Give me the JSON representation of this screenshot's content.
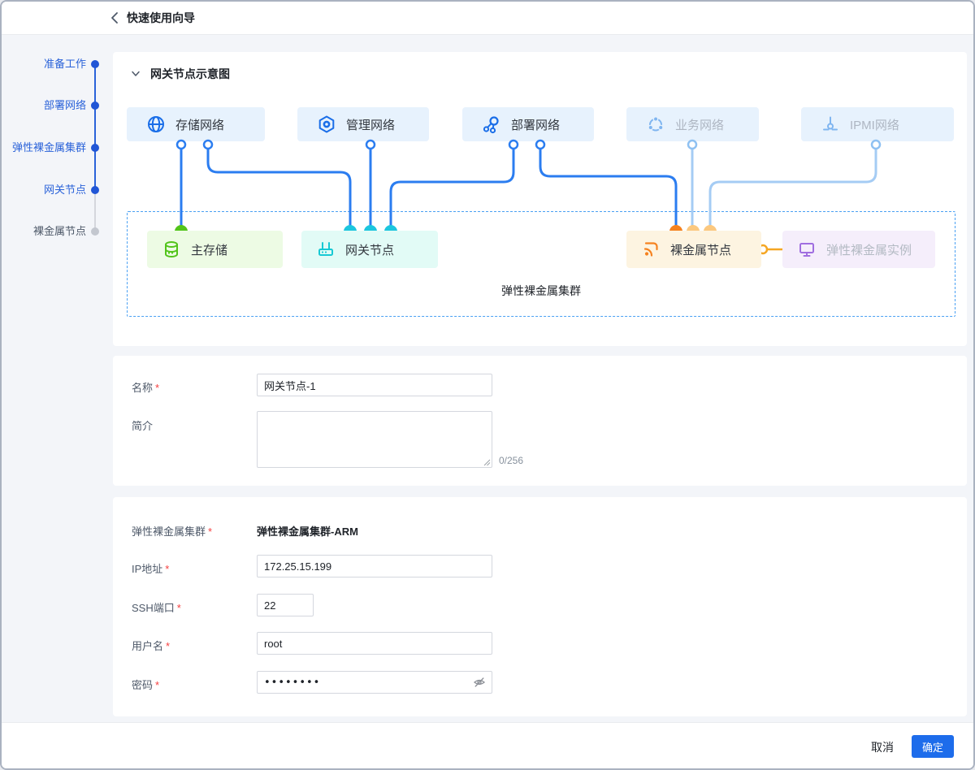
{
  "header": {
    "title": "快速使用向导"
  },
  "stepper": {
    "steps": [
      {
        "label": "准备工作",
        "state": "done"
      },
      {
        "label": "部署网络",
        "state": "done"
      },
      {
        "label": "弹性裸金属集群",
        "state": "done"
      },
      {
        "label": "网关节点",
        "state": "current"
      },
      {
        "label": "裸金属节点",
        "state": "pending"
      }
    ]
  },
  "diagram": {
    "section_title": "网关节点示意图",
    "networks": [
      {
        "label": "存储网络",
        "state": "active"
      },
      {
        "label": "管理网络",
        "state": "active"
      },
      {
        "label": "部署网络",
        "state": "active"
      },
      {
        "label": "业务网络",
        "state": "disabled"
      },
      {
        "label": "IPMI网络",
        "state": "disabled"
      }
    ],
    "nodes": [
      {
        "label": "主存储",
        "color": "green"
      },
      {
        "label": "网关节点",
        "color": "cyan"
      },
      {
        "label": "裸金属节点",
        "color": "orange"
      },
      {
        "label": "弹性裸金属实例",
        "color": "purple"
      }
    ],
    "cluster_label": "弹性裸金属集群"
  },
  "form": {
    "required_mark": "*",
    "name": {
      "label": "名称",
      "value": "网关节点-1"
    },
    "description": {
      "label": "简介",
      "value": "",
      "counter": "0/256"
    },
    "cluster": {
      "label": "弹性裸金属集群",
      "value": "弹性裸金属集群-ARM"
    },
    "ip": {
      "label": "IP地址",
      "value": "172.25.15.199"
    },
    "ssh_port": {
      "label": "SSH端口",
      "value": "22"
    },
    "username": {
      "label": "用户名",
      "value": "root"
    },
    "password": {
      "label": "密码",
      "value": "••••••••"
    }
  },
  "footer": {
    "cancel_label": "取消",
    "confirm_label": "确定"
  },
  "colors": {
    "primary": "#1d6ceb",
    "step_blue": "#2a62d9",
    "wire_blue": "#2b7df0",
    "wire_light": "#a5ccf4",
    "dot_green": "#52c41a",
    "dot_cyan": "#1cc6de",
    "dot_orange": "#f5821f",
    "dot_orange_light": "#fbc87f",
    "icon_blue": "#1a6ee8",
    "icon_blue_light": "#7fb5f0",
    "icon_green": "#52c41a",
    "icon_cyan": "#17c9d4",
    "icon_orange": "#f5821f",
    "icon_purple": "#a06ee0",
    "dashed_border": "#4aa0f3"
  }
}
